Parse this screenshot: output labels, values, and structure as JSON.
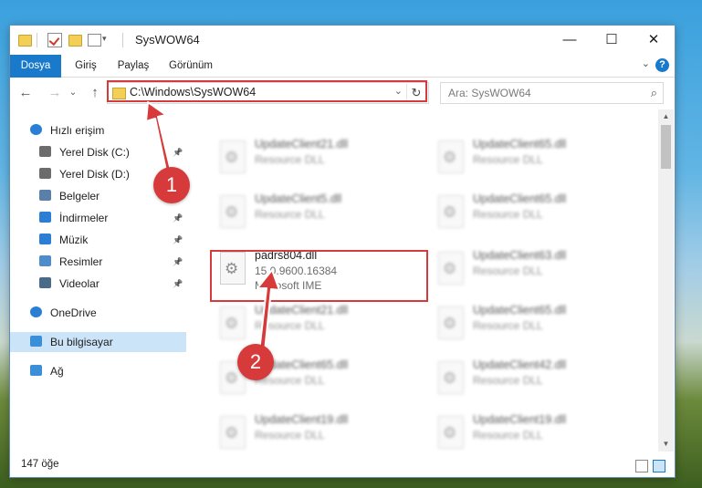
{
  "window": {
    "title": "SysWOW64",
    "controls": {
      "minimize": "—",
      "maximize": "☐",
      "close": "✕"
    }
  },
  "ribbon": {
    "tabs": [
      "Dosya",
      "Giriş",
      "Paylaş",
      "Görünüm"
    ],
    "help": "?",
    "expand": "⌄"
  },
  "nav": {
    "back": "←",
    "forward": "→",
    "recent": "⌄",
    "up": "↑",
    "address": "C:\\Windows\\SysWOW64",
    "address_dropdown": "⌄",
    "refresh": "↻",
    "search_placeholder": "Ara: SysWOW64",
    "search_icon": "⌕"
  },
  "sidebar": {
    "items": [
      {
        "label": "Hızlı erişim",
        "icon": "star-icon",
        "pinned": false
      },
      {
        "label": "Yerel Disk (C:)",
        "icon": "drive-icon",
        "pinned": true
      },
      {
        "label": "Yerel Disk (D:)",
        "icon": "drive-icon",
        "pinned": false
      },
      {
        "label": "Belgeler",
        "icon": "documents-icon",
        "pinned": true
      },
      {
        "label": "İndirmeler",
        "icon": "download-icon",
        "pinned": true
      },
      {
        "label": "Müzik",
        "icon": "music-icon",
        "pinned": true
      },
      {
        "label": "Resimler",
        "icon": "pictures-icon",
        "pinned": true
      },
      {
        "label": "Videolar",
        "icon": "videos-icon",
        "pinned": true
      },
      {
        "label": "OneDrive",
        "icon": "cloud-icon",
        "pinned": false
      },
      {
        "label": "Bu bilgisayar",
        "icon": "computer-icon",
        "pinned": false,
        "selected": true
      },
      {
        "label": "Ağ",
        "icon": "network-icon",
        "pinned": false
      }
    ],
    "pin_glyph": "📌"
  },
  "files": [
    {
      "name": "UpdateClient21.dll",
      "line2": "Resource DLL",
      "line3": "",
      "blurred": true
    },
    {
      "name": "UpdateClient65.dll",
      "line2": "Resource DLL",
      "line3": "",
      "blurred": true
    },
    {
      "name": "UpdateClient5.dll",
      "line2": "Resource DLL",
      "line3": "",
      "blurred": true
    },
    {
      "name": "UpdateClient65.dll",
      "line2": "Resource DLL",
      "line3": "",
      "blurred": true
    },
    {
      "name": "padrs804.dll",
      "line2": "15.0.9600.16384",
      "line3": "Microsoft IME",
      "blurred": false
    },
    {
      "name": "UpdateClient63.dll",
      "line2": "Resource DLL",
      "line3": "",
      "blurred": true
    },
    {
      "name": "UpdateClient21.dll",
      "line2": "Resource DLL",
      "line3": "",
      "blurred": true
    },
    {
      "name": "UpdateClient65.dll",
      "line2": "Resource DLL",
      "line3": "",
      "blurred": true
    },
    {
      "name": "UpdateClient65.dll",
      "line2": "Resource DLL",
      "line3": "",
      "blurred": true
    },
    {
      "name": "UpdateClient42.dll",
      "line2": "Resource DLL",
      "line3": "",
      "blurred": true
    },
    {
      "name": "UpdateClient19.dll",
      "line2": "Resource DLL",
      "line3": "",
      "blurred": true
    },
    {
      "name": "UpdateClient19.dll",
      "line2": "Resource DLL",
      "line3": "",
      "blurred": true
    }
  ],
  "status": {
    "item_count": "147 öğe"
  },
  "callouts": {
    "step1": "1",
    "step2": "2"
  },
  "colors": {
    "accent": "#1979ca",
    "highlight": "#d73a3a",
    "selected": "#cce4f7"
  }
}
